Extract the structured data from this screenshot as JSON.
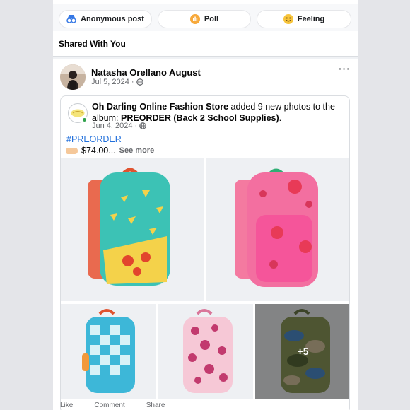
{
  "composer": {
    "anonymous_label": "Anonymous post",
    "poll_label": "Poll",
    "feeling_label": "Feeling"
  },
  "section": {
    "title": "Shared With You"
  },
  "post": {
    "author": "Natasha Orellano August",
    "date": "Jul 5, 2024 ·",
    "privacy_icon": "globe-icon",
    "more_label": "···"
  },
  "shared": {
    "page_name": "Oh Darling Online Fashion Store",
    "action_text": " added 9 new photos to the album: ",
    "album": "PREORDER (Back 2 School Supplies)",
    "period": ".",
    "date": "Jun 4, 2024 ·",
    "hashtag": "#PREORDER",
    "price": "$74.00...",
    "see_more": "See more",
    "more_count": "+5"
  },
  "footer": {
    "like": "Like",
    "comment": "Comment",
    "share": "Share"
  },
  "colors": {
    "link": "#216fdb",
    "muted": "#65676b",
    "online": "#31a24c"
  }
}
